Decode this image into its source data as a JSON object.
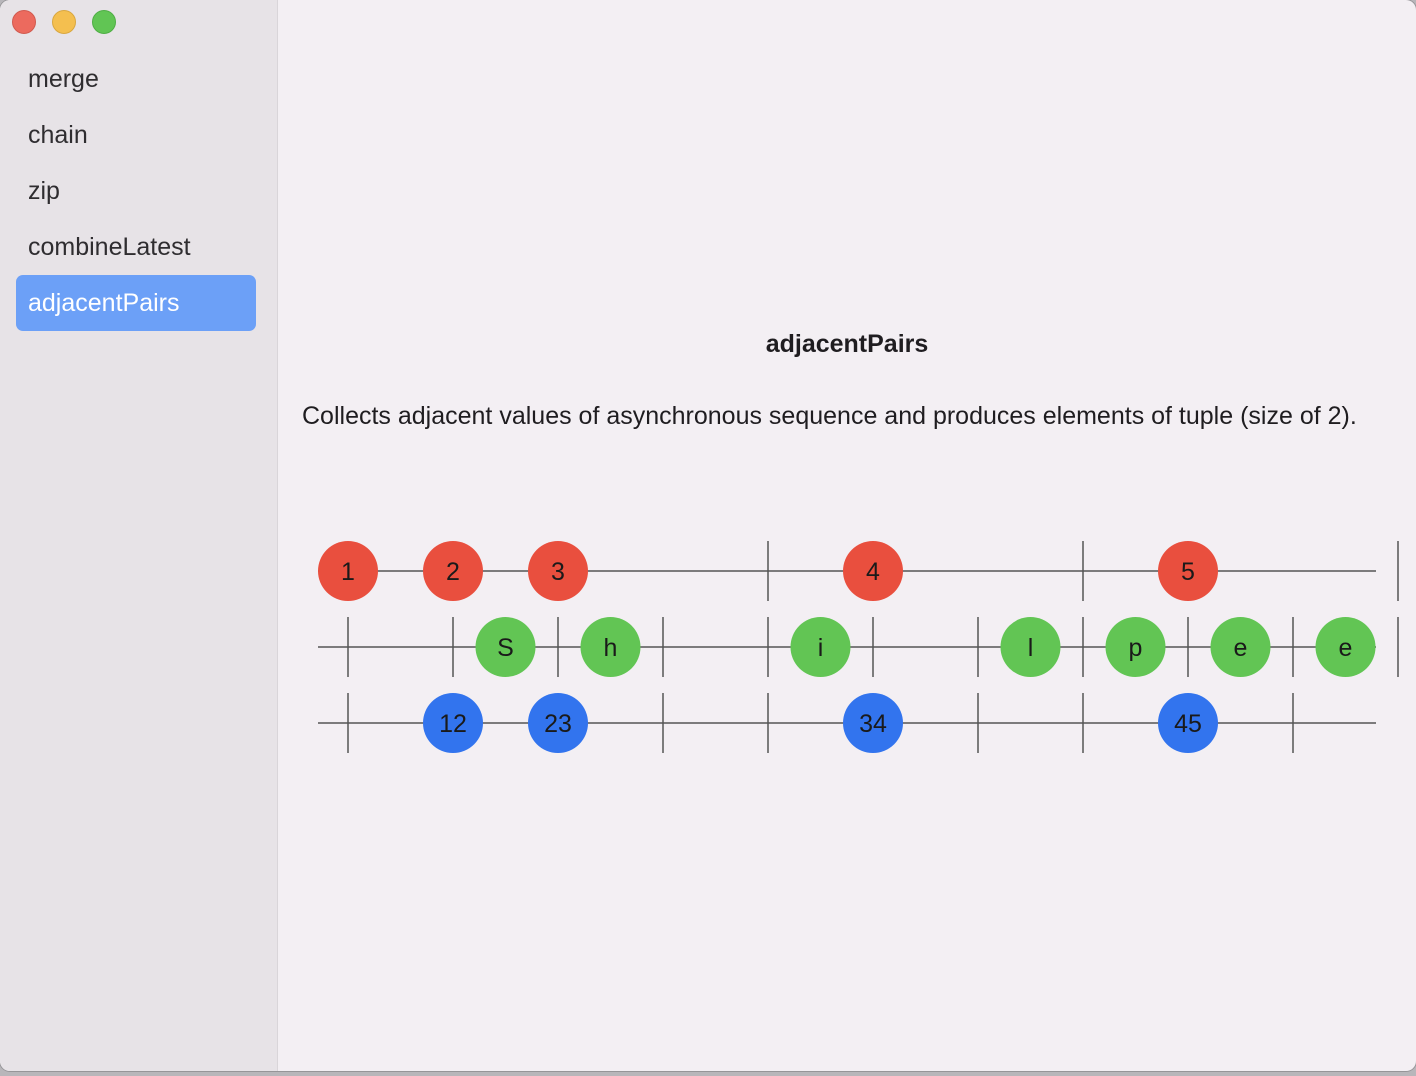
{
  "window": {
    "controls": {
      "close": "close-button",
      "minimize": "minimize-button",
      "zoom": "zoom-button"
    }
  },
  "sidebar": {
    "items": [
      {
        "label": "merge",
        "selected": false
      },
      {
        "label": "chain",
        "selected": false
      },
      {
        "label": "zip",
        "selected": false
      },
      {
        "label": "combineLatest",
        "selected": false
      },
      {
        "label": "adjacentPairs",
        "selected": true
      }
    ]
  },
  "detail": {
    "title": "adjacentPairs",
    "description": "Collects adjacent values of asynchronous sequence and produces elements of tuple (size of 2)."
  },
  "diagram": {
    "colors": {
      "input": "#e94f3e",
      "secondary": "#62c554",
      "output": "#3274ee",
      "line": "#555555"
    },
    "rows": [
      {
        "name": "input-row",
        "color": "#e94f3e",
        "ticks": [
          4,
          5,
          7,
          8,
          10
        ],
        "marbles": [
          {
            "slot": 0,
            "label": "1"
          },
          {
            "slot": 1,
            "label": "2"
          },
          {
            "slot": 2,
            "label": "3"
          },
          {
            "slot": 5,
            "label": "4"
          },
          {
            "slot": 8,
            "label": "5"
          }
        ]
      },
      {
        "name": "secondary-row",
        "color": "#62c554",
        "ticks": [
          0,
          1,
          2,
          3,
          4,
          5,
          6,
          7,
          8,
          9,
          10
        ],
        "marbles": [
          {
            "slot": 1.5,
            "label": "S"
          },
          {
            "slot": 2.5,
            "label": "h"
          },
          {
            "slot": 4.5,
            "label": "i"
          },
          {
            "slot": 6.5,
            "label": "l"
          },
          {
            "slot": 7.5,
            "label": "p"
          },
          {
            "slot": 8.5,
            "label": "e"
          },
          {
            "slot": 9.5,
            "label": "e"
          }
        ]
      },
      {
        "name": "output-row",
        "color": "#3274ee",
        "ticks": [
          0,
          3,
          4,
          6,
          7,
          9
        ],
        "marbles": [
          {
            "slot": 1,
            "label": "12"
          },
          {
            "slot": 2,
            "label": "23"
          },
          {
            "slot": 5,
            "label": "34"
          },
          {
            "slot": 8,
            "label": "45"
          }
        ]
      }
    ]
  }
}
